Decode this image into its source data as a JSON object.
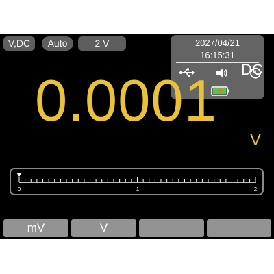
{
  "header": {
    "mode": "V,DC",
    "auto": "Auto",
    "range": "2 V"
  },
  "status": {
    "date": "2027/04/21",
    "time": "16:15:31",
    "icons": [
      "usb-icon",
      "speaker-icon",
      "history-icon",
      "indicator-dot-icon",
      "battery-icon"
    ],
    "indicator_color": "#e8782a"
  },
  "reading": {
    "value": "0.0001",
    "coupling": "DC",
    "unit": "V"
  },
  "bargraph": {
    "ticks": [
      "0",
      "1",
      "2"
    ],
    "min": 0,
    "max": 2,
    "value": 0.0001
  },
  "softkeys": [
    "mV",
    "V",
    "",
    ""
  ],
  "colors": {
    "reading": "#e9c13a",
    "background": "#000000",
    "chip": "#5e5e5e",
    "softkey": "#939393"
  }
}
